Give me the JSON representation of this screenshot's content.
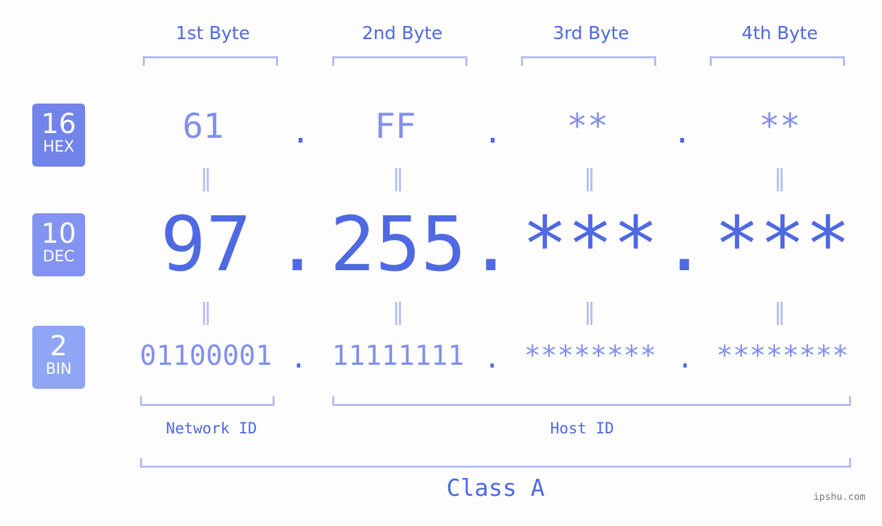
{
  "bytes": [
    {
      "label": "1st Byte",
      "hex": "61",
      "dec": "97",
      "bin": "01100001"
    },
    {
      "label": "2nd Byte",
      "hex": "FF",
      "dec": "255",
      "bin": "11111111"
    },
    {
      "label": "3rd Byte",
      "hex": "**",
      "dec": "***",
      "bin": "********"
    },
    {
      "label": "4th Byte",
      "hex": "**",
      "dec": "***",
      "bin": "********"
    }
  ],
  "badges": {
    "hex": {
      "num": "16",
      "label": "HEX",
      "color": "#7283ea"
    },
    "dec": {
      "num": "10",
      "label": "DEC",
      "color": "#8394f0"
    },
    "bin": {
      "num": "2",
      "label": "BIN",
      "color": "#8fa6f5"
    }
  },
  "separator": ".",
  "equals": "=",
  "network_label": "Network ID",
  "host_label": "Host ID",
  "class_label": "Class A",
  "watermark": "ipshu.com"
}
